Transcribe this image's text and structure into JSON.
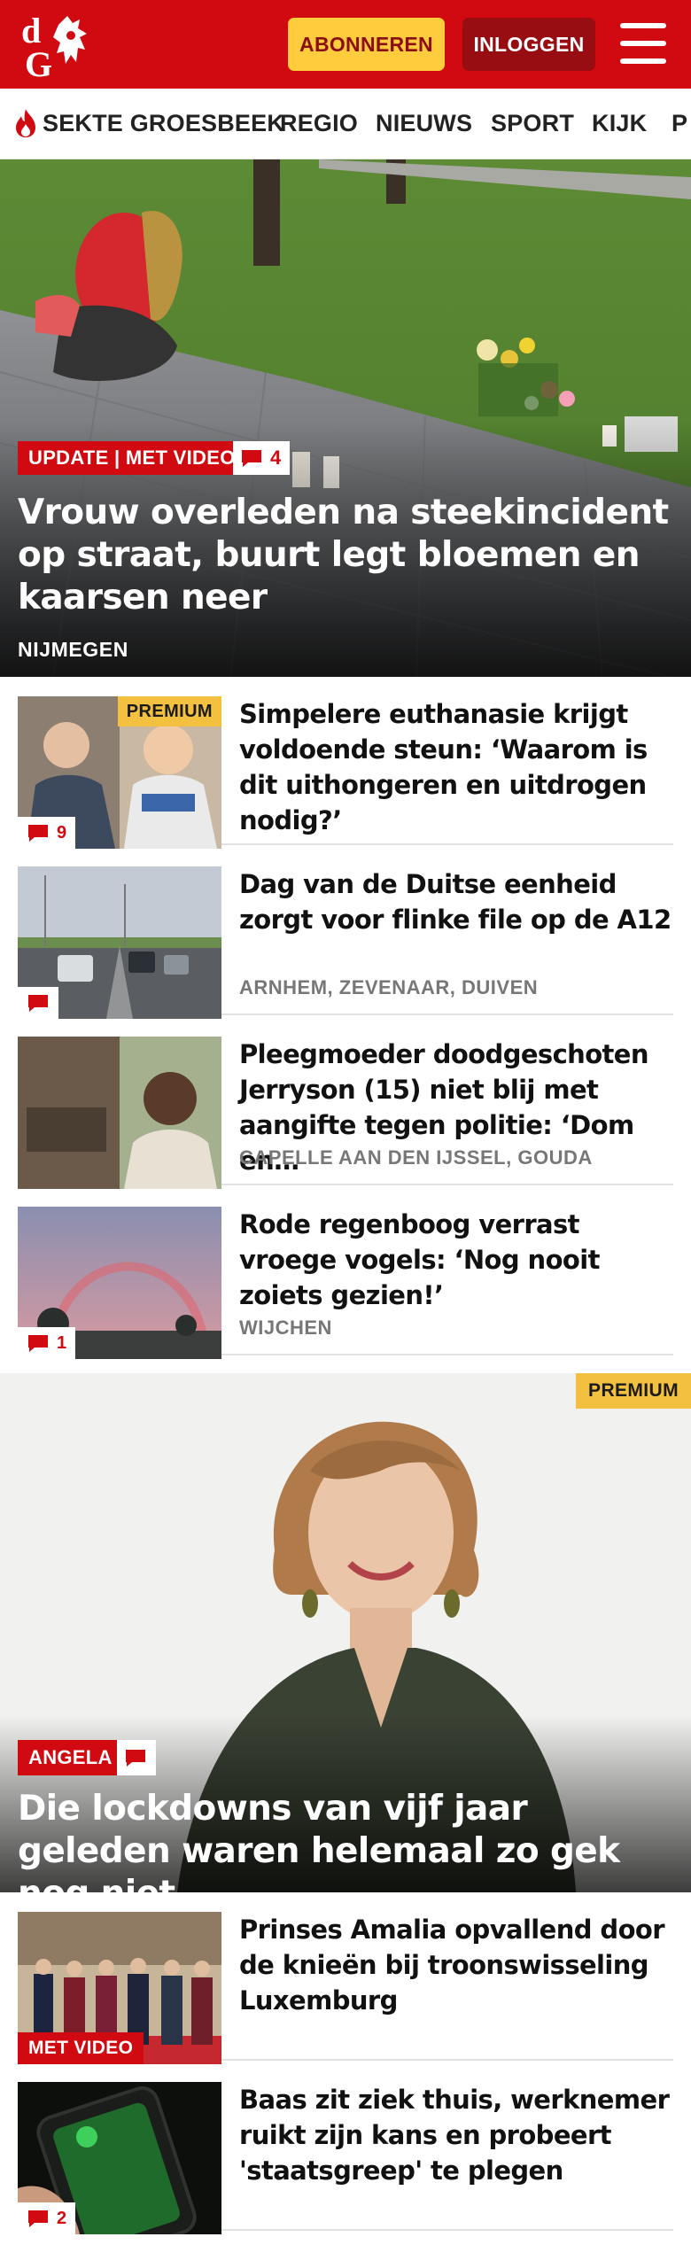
{
  "header": {
    "logo_text": "dG",
    "subscribe_label": "ABONNEREN",
    "login_label": "INLOGGEN",
    "menu_icon": "hamburger-menu-icon",
    "brand_color": "#d10a11"
  },
  "nav": {
    "items": [
      {
        "label": "SEKTE GROESBEEK",
        "icon": "fire-icon"
      },
      {
        "label": "REGIO"
      },
      {
        "label": "NIEUWS"
      },
      {
        "label": "SPORT"
      },
      {
        "label": "KIJK"
      },
      {
        "label": "P"
      }
    ]
  },
  "hero": {
    "tag": "UPDATE | MET VIDEO",
    "comments": "4",
    "title": "Vrouw overleden na steekincident op straat, buurt legt bloemen en kaarsen neer",
    "location": "NIJMEGEN"
  },
  "articles": [
    {
      "badge": "PREMIUM",
      "comments": "9",
      "title": "Simpelere euthanasie krijgt voldoende steun: ‘Waarom is dit uithongeren en uitdrogen nodig?’",
      "location": ""
    },
    {
      "comments": "",
      "title": "Dag van de Duitse eenheid zorgt voor flinke file op de A12",
      "location": "ARNHEM, ZEVENAAR, DUIVEN"
    },
    {
      "title": "Pleegmoeder doodgeschoten Jerryson (15) niet blij met aangifte tegen politie: ‘Dom en…",
      "location": "CAPELLE AAN DEN IJSSEL, GOUDA"
    },
    {
      "comments": "1",
      "title": "Rode regenboog verrast vroege vogels: ‘Nog nooit zoiets gezien!’",
      "location": "WIJCHEN"
    }
  ],
  "feature": {
    "badge": "PREMIUM",
    "tag": "ANGELA",
    "title": "Die lockdowns van vijf jaar geleden waren helemaal zo gek nog niet"
  },
  "articles2": [
    {
      "tag": "MET VIDEO",
      "title": "Prinses Amalia opvallend door de knieën bij troonswisseling Luxemburg"
    },
    {
      "comments": "2",
      "title": "Baas zit ziek thuis, werknemer ruikt zijn kans en probeert 'staatsgreep' te plegen"
    }
  ]
}
